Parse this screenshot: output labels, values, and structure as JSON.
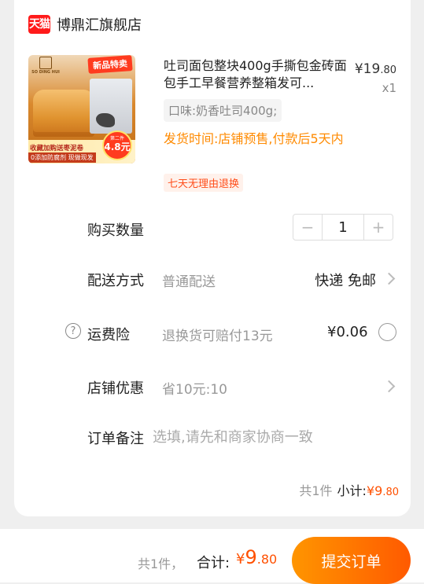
{
  "store": {
    "badge": "天猫",
    "name": "博鼎汇旗舰店"
  },
  "product": {
    "image": {
      "brand": "SO DING HUI",
      "new_tag": "新品特卖",
      "promo_line1": "收藏加购送枣泥卷",
      "promo_line2": "0添加防腐剂 现做现发",
      "burst_top": "第二件",
      "burst_amount": "4.8元"
    },
    "title": "吐司面包整块400g手撕包金砖面包手工早餐营养整箱发可...",
    "price_symbol": "¥",
    "price_int": "19",
    "price_dec": ".80",
    "quantity_label": "x1",
    "variant": "口味:奶香吐司400g;",
    "ship_time": "发货时间:店铺预售,付款后5天内",
    "return_policy": "七天无理由退换"
  },
  "rows": {
    "quantity": {
      "label": "购买数量",
      "value": "1",
      "minus": "−",
      "plus": "+"
    },
    "delivery": {
      "label": "配送方式",
      "sub": "普通配送",
      "value": "快递 免邮"
    },
    "insurance": {
      "help": "?",
      "label": "运费险",
      "sub": "退换货可赔付13元",
      "value": "¥0.06"
    },
    "discount": {
      "label": "店铺优惠",
      "sub": "省10元:10"
    },
    "note": {
      "label": "订单备注",
      "placeholder": "选填,请先和商家协商一致"
    }
  },
  "subtotal": {
    "count": "共1件",
    "label": "小计:",
    "amount_symbol": "¥",
    "amount_int": "9",
    "amount_dec": ".80"
  },
  "footer": {
    "count": "共1件，",
    "total_label": "合计:",
    "total_symbol": "¥",
    "total_int": "9",
    "total_dec": ".80",
    "submit": "提交订单"
  },
  "colors": {
    "accent": "#ff5000",
    "ship_time": "#ff8a00",
    "tmall_red": "#ff1a1a",
    "button_start": "#ff9500",
    "button_end": "#ff5a00"
  }
}
